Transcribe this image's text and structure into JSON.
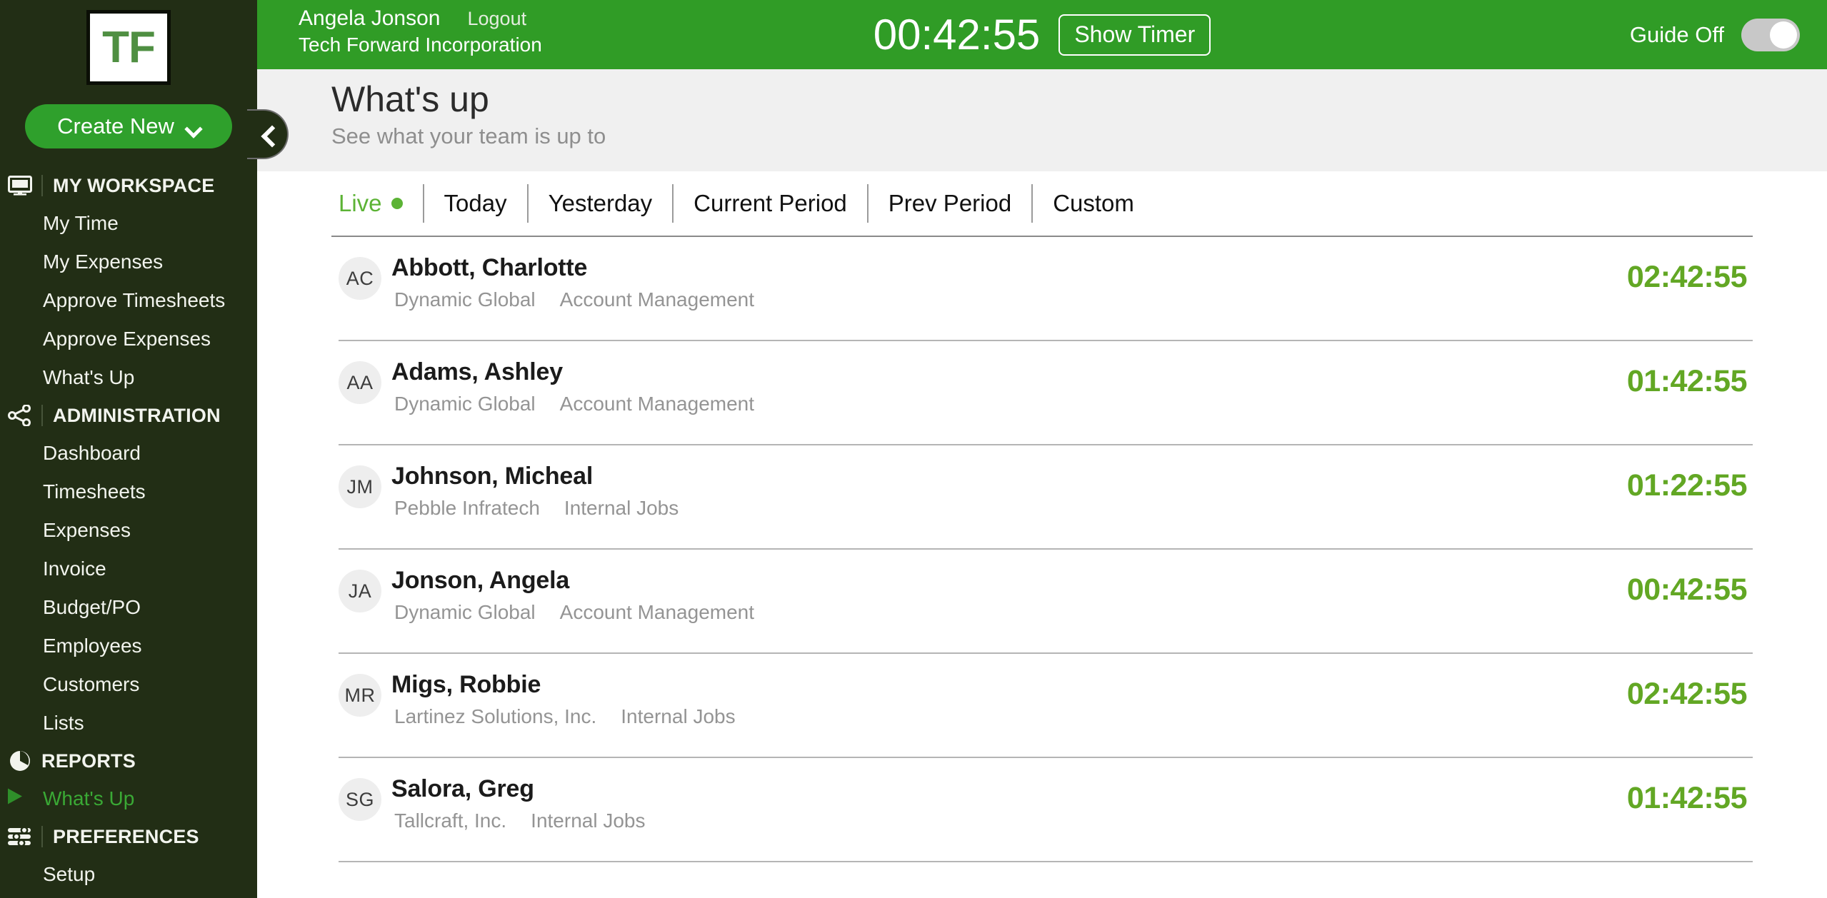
{
  "sidebar": {
    "logo_text": "TF",
    "create_new_label": "Create New",
    "sections": [
      {
        "label": "MY WORKSPACE",
        "icon": "monitor-icon",
        "items": [
          {
            "label": "My Time",
            "active": false
          },
          {
            "label": "My Expenses",
            "active": false
          },
          {
            "label": "Approve Timesheets",
            "active": false
          },
          {
            "label": "Approve Expenses",
            "active": false
          },
          {
            "label": "What's Up",
            "active": false
          }
        ]
      },
      {
        "label": "ADMINISTRATION",
        "icon": "share-nodes-icon",
        "items": [
          {
            "label": "Dashboard",
            "active": false
          },
          {
            "label": "Timesheets",
            "active": false
          },
          {
            "label": "Expenses",
            "active": false
          },
          {
            "label": "Invoice",
            "active": false
          },
          {
            "label": "Budget/PO",
            "active": false
          },
          {
            "label": "Employees",
            "active": false
          },
          {
            "label": "Customers",
            "active": false
          },
          {
            "label": "Lists",
            "active": false
          }
        ]
      },
      {
        "label": "REPORTS",
        "icon": "pie-chart-icon",
        "items": [
          {
            "label": "What's Up",
            "active": true
          }
        ]
      },
      {
        "label": "PREFERENCES",
        "icon": "sliders-icon",
        "items": [
          {
            "label": "Setup",
            "active": false
          }
        ]
      }
    ]
  },
  "topbar": {
    "user_name": "Angela Jonson",
    "logout_label": "Logout",
    "company": "Tech Forward Incorporation",
    "timer_value": "00:42:55",
    "show_timer_label": "Show Timer",
    "guide_label": "Guide Off",
    "guide_on": false
  },
  "page": {
    "title": "What's up",
    "subtitle": "See what your team is up to"
  },
  "tabs": [
    {
      "label": "Live",
      "active": true,
      "has_dot": true
    },
    {
      "label": "Today",
      "active": false,
      "has_dot": false
    },
    {
      "label": "Yesterday",
      "active": false,
      "has_dot": false
    },
    {
      "label": "Current Period",
      "active": false,
      "has_dot": false
    },
    {
      "label": "Prev Period",
      "active": false,
      "has_dot": false
    },
    {
      "label": "Custom",
      "active": false,
      "has_dot": false
    }
  ],
  "rows": [
    {
      "initials": "AC",
      "name": "Abbott, Charlotte",
      "customer": "Dynamic Global",
      "job": "Account Management",
      "time": "02:42:55"
    },
    {
      "initials": "AA",
      "name": "Adams, Ashley",
      "customer": "Dynamic Global",
      "job": "Account Management",
      "time": "01:42:55"
    },
    {
      "initials": "JM",
      "name": "Johnson, Micheal",
      "customer": "Pebble Infratech",
      "job": "Internal Jobs",
      "time": "01:22:55"
    },
    {
      "initials": "JA",
      "name": "Jonson, Angela",
      "customer": "Dynamic Global",
      "job": "Account Management",
      "time": "00:42:55"
    },
    {
      "initials": "MR",
      "name": "Migs, Robbie",
      "customer": "Lartinez Solutions, Inc.",
      "job": "Internal Jobs",
      "time": "02:42:55"
    },
    {
      "initials": "SG",
      "name": "Salora, Greg",
      "customer": "Tallcraft, Inc.",
      "job": "Internal Jobs",
      "time": "01:42:55"
    }
  ],
  "colors": {
    "sidebar_bg": "#222e15",
    "topbar_green": "#309c26",
    "accent_green": "#2fa02c",
    "time_green": "#62a724",
    "live_green": "#5cb335",
    "page_head_bg": "#f0f0f0"
  }
}
